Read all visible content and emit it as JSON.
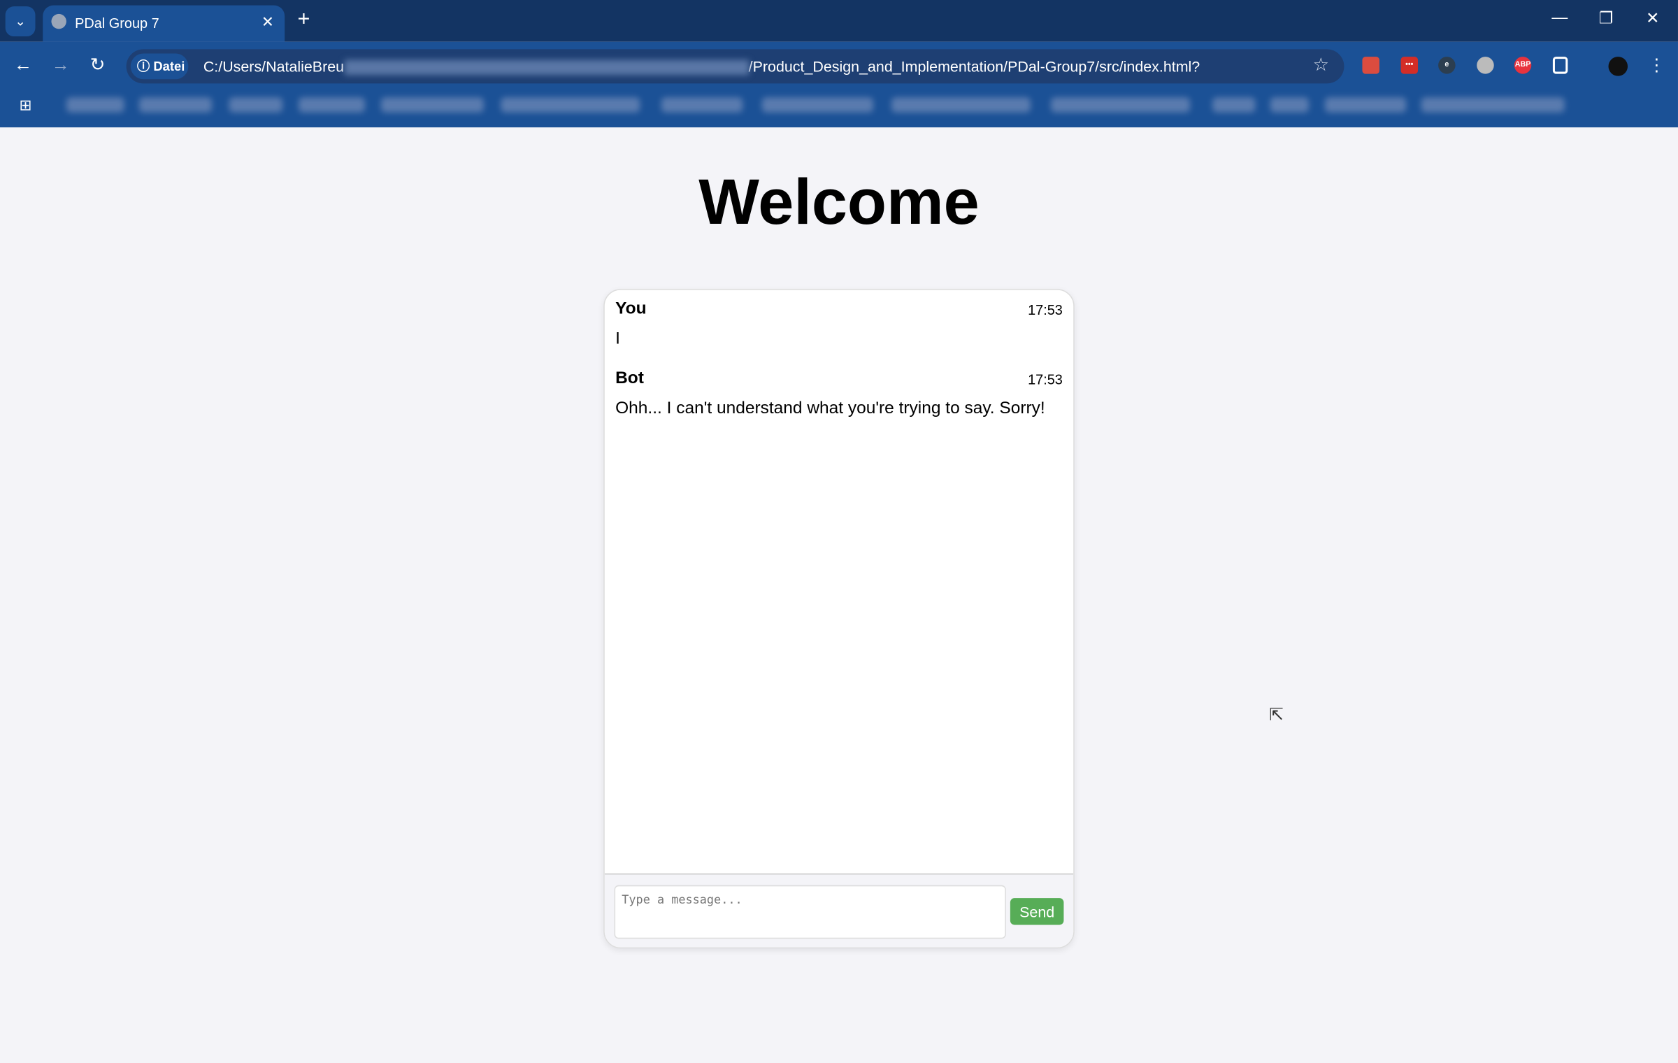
{
  "browser": {
    "tab_title": "PDal Group 7",
    "site_chip": "Datei",
    "url_prefix": "C:/Users/NatalieBreu",
    "url_suffix": "/Product_Design_and_Implementation/PDal-Group7/src/index.html?",
    "extensions": [
      {
        "name": "todoist",
        "color": "#db4c3f",
        "label": ""
      },
      {
        "name": "lastpass",
        "color": "#d32d27",
        "label": "•••"
      },
      {
        "name": "ghostery",
        "color": "#2c3e50",
        "label": "e"
      },
      {
        "name": "grey-ext",
        "color": "#bbbbbb",
        "label": ""
      },
      {
        "name": "adblock-plus",
        "color": "#e8333e",
        "label": "ABP"
      }
    ]
  },
  "page": {
    "title": "Welcome"
  },
  "chat": {
    "messages": [
      {
        "sender": "You",
        "time": "17:53",
        "text": "I"
      },
      {
        "sender": "Bot",
        "time": "17:53",
        "text": "Ohh... I can't understand what you're trying to say. Sorry!"
      }
    ],
    "input_placeholder": "Type a message...",
    "send_label": "Send"
  },
  "colors": {
    "accent": "#57ad57",
    "chrome": "#1b5196"
  }
}
